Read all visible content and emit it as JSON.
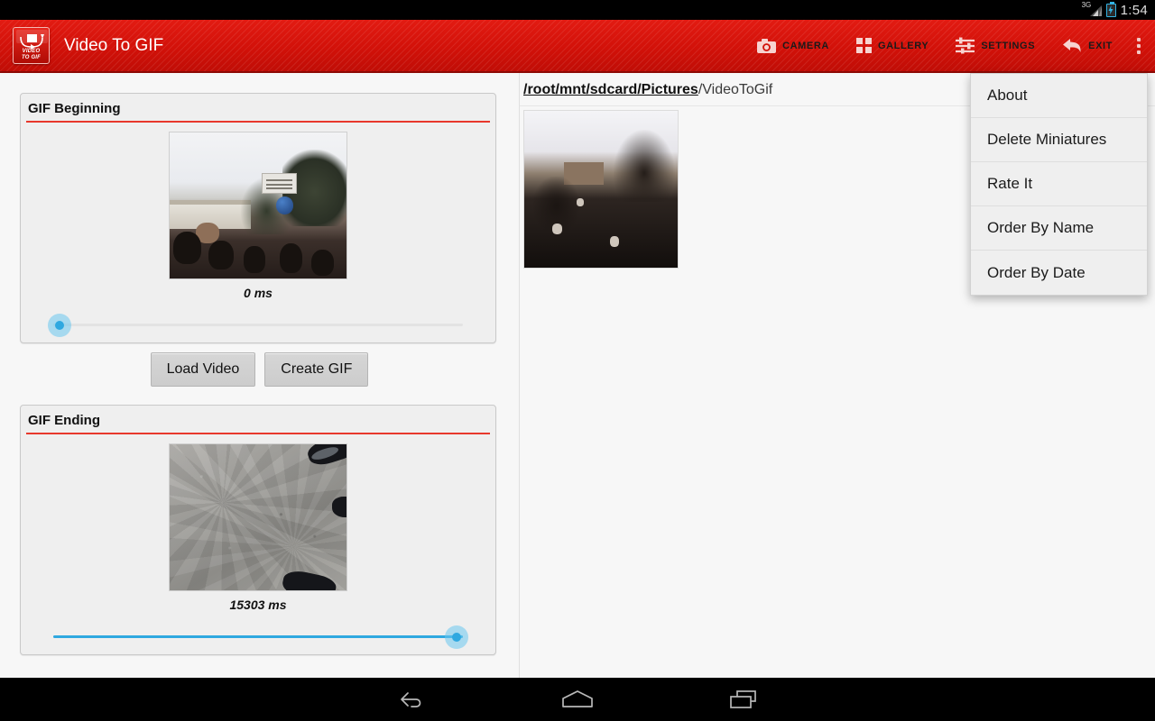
{
  "statusbar": {
    "network_label": "3G",
    "clock": "1:54",
    "battery_icon": "battery-charging-icon",
    "signal_icon": "signal-bars-icon"
  },
  "actionbar": {
    "app_title": "Video To GIF",
    "logo_line1": "VIDEO",
    "logo_line2": "TO GIF",
    "actions": [
      {
        "label": "CAMERA",
        "icon": "camera-icon"
      },
      {
        "label": "GALLERY",
        "icon": "grid-icon"
      },
      {
        "label": "SETTINGS",
        "icon": "sliders-icon"
      },
      {
        "label": "EXIT",
        "icon": "back-arrow-icon"
      }
    ],
    "overflow_icon": "overflow-menu-icon",
    "bar_color": "#d21109"
  },
  "overflow_menu": {
    "open": true,
    "items": [
      {
        "label": "About"
      },
      {
        "label": "Delete Miniatures"
      },
      {
        "label": "Rate It"
      },
      {
        "label": "Order By Name"
      },
      {
        "label": "Order By Date"
      }
    ]
  },
  "left_pane": {
    "beginning": {
      "title": "GIF Beginning",
      "time_label": "0 ms",
      "slider_percent": 0,
      "thumbnail_alt": "crowd-protest-frame"
    },
    "ending": {
      "title": "GIF Ending",
      "time_label": "15303 ms",
      "slider_percent": 100,
      "thumbnail_alt": "asphalt-ground-frame"
    },
    "buttons": [
      {
        "label": "Load Video"
      },
      {
        "label": "Create GIF"
      }
    ],
    "accent_color": "#e8382c",
    "slider_color": "#2fa8e0"
  },
  "right_pane": {
    "breadcrumb_link": "/root/mnt/sdcard/Pictures",
    "breadcrumb_tail": "/VideoToGif",
    "items": [
      {
        "alt": "crowd-thumbnail"
      }
    ]
  },
  "navbar": {
    "buttons": [
      {
        "icon": "nav-back-icon"
      },
      {
        "icon": "nav-home-icon"
      },
      {
        "icon": "nav-recents-icon"
      }
    ]
  }
}
